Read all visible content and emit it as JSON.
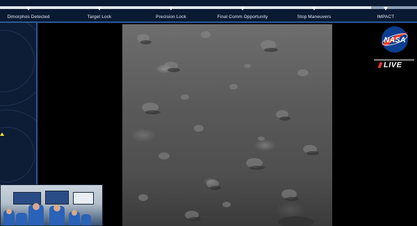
{
  "timeline": {
    "stages": [
      {
        "label": "Dimorphos Detected"
      },
      {
        "label": "Target Lock"
      },
      {
        "label": "Precision Lock"
      },
      {
        "label": "Final Comm Opportunity"
      },
      {
        "label": "Stop Maneuvers"
      },
      {
        "label": "IMPACT"
      }
    ],
    "progress_percent": 89
  },
  "broadcast": {
    "logo": "NASA",
    "live_label": "LIVE"
  },
  "colors": {
    "timeline_bg": "#0b1a33",
    "timeline_accent": "#2c5a97",
    "live_mark": "#e83a2a",
    "nasa_blue": "#0b3d91",
    "nasa_red": "#fc3d21"
  },
  "icons": {
    "alert": "warning-triangle-icon",
    "stage_marker": "triangle-down-icon"
  }
}
